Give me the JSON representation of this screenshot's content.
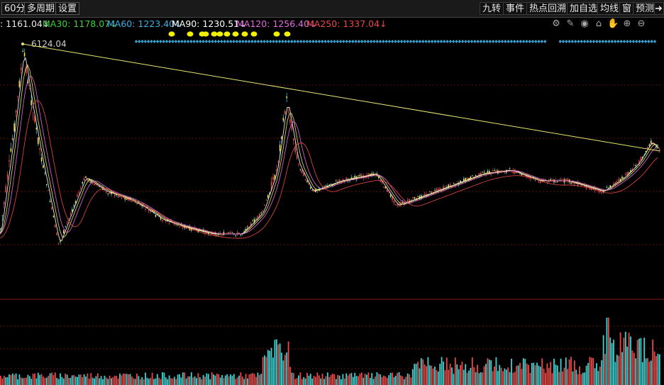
{
  "toolbar": {
    "period": "60分",
    "multi_period": "多周期",
    "settings": "设置",
    "right_items": [
      "九转",
      "事件",
      "热点回溯",
      "加自选",
      "均线",
      "窗",
      "预测"
    ]
  },
  "ma_bar": [
    {
      "text": ": 1161.04↓",
      "color": "#e8e8e8"
    },
    {
      "text": "MA30: 1178.07↓",
      "color": "#3cd13c"
    },
    {
      "text": "MA60: 1223.40↓",
      "color": "#3ab0e6"
    },
    {
      "text": "MA90: 1230.51↓",
      "color": "#ffffff"
    },
    {
      "text": "MA120: 1256.40↓",
      "color": "#e36ae3"
    },
    {
      "text": "MA250: 1337.04↓",
      "color": "#e84a4a"
    }
  ],
  "chart_tools": [
    "settings-icon",
    "draw-icon",
    "eye-icon",
    "basket-icon",
    "hand-icon",
    "zoom-in-icon",
    "zoom-out-icon"
  ],
  "chart_data": {
    "type": "line",
    "peak_label": "6124.04",
    "x": [
      0,
      20,
      33,
      45,
      60,
      83,
      100,
      120,
      150,
      180,
      200,
      230,
      260,
      300,
      340,
      370,
      390,
      404,
      420,
      440,
      480,
      530,
      560,
      600,
      640,
      680,
      720,
      760,
      800,
      850,
      880,
      900,
      918,
      928
    ],
    "series": [
      {
        "values": [
          330,
          180,
          70,
          150,
          230,
          345,
          300,
          250,
          270,
          280,
          290,
          310,
          320,
          330,
          330,
          300,
          240,
          140,
          230,
          270,
          255,
          245,
          290,
          275,
          260,
          245,
          240,
          255,
          255,
          270,
          250,
          230,
          200,
          210
        ]
      }
    ]
  },
  "colors": {
    "bg": "#000000",
    "up": "#e84a4a",
    "down": "#3fd0d0",
    "trendline": "#e8e870",
    "gridline": "#6a1010",
    "marker_yellow": "#f0f000",
    "marker_blue": "#3aa0d0"
  }
}
